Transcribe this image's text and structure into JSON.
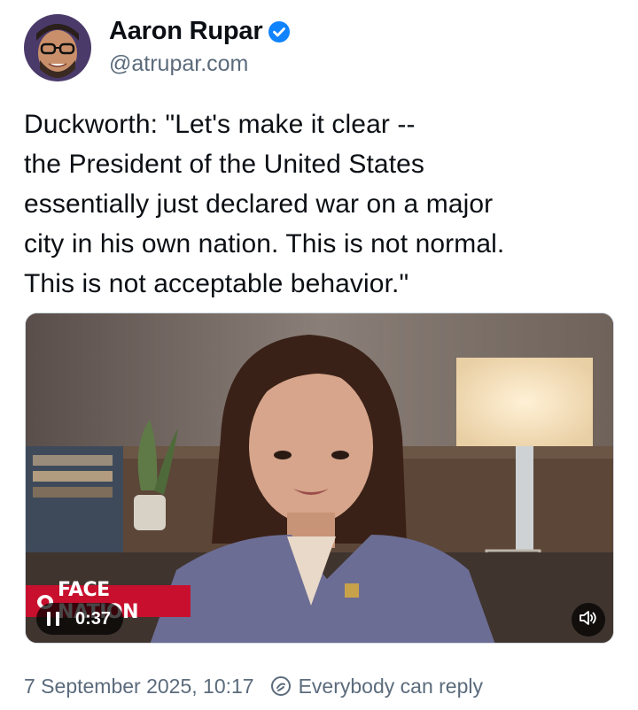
{
  "author": {
    "display_name": "Aaron Rupar",
    "handle": "@atrupar.com",
    "verified": true
  },
  "post": {
    "text": "Duckworth: \"Let's make it clear --\nthe President of the United States\nessentially just declared war on a major\ncity in his own nation. This is not normal.\nThis is not acceptable behavior.\""
  },
  "video": {
    "current_time": "0:37",
    "playing": true,
    "muted": false,
    "overlay_logo": "FACE NATION"
  },
  "footer": {
    "timestamp": "7 September 2025, 10:17",
    "reply_setting": "Everybody can reply"
  },
  "colors": {
    "verified_blue": "#1083fe",
    "text": "#0b0f14",
    "muted_text": "#5b6b7c",
    "brand_red": "#c8102e"
  },
  "icons": {
    "verified": "verified-check-icon",
    "pause": "pause-icon",
    "volume": "volume-icon",
    "reply": "reply-settings-icon"
  }
}
